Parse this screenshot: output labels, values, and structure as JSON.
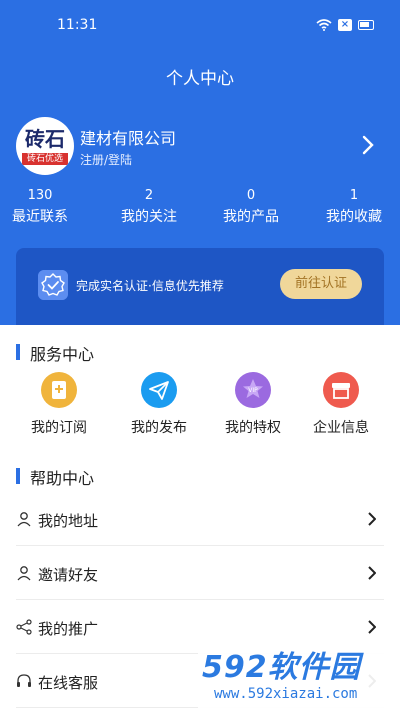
{
  "status_bar": {
    "time": "11:31"
  },
  "header": {
    "title": "个人中心"
  },
  "profile": {
    "logo_text": "砖石",
    "logo_band": "砖石优选",
    "company": "建材有限公司",
    "login": "注册/登陆"
  },
  "stats": [
    {
      "value": "130",
      "label": "最近联系"
    },
    {
      "value": "2",
      "label": "我的关注"
    },
    {
      "value": "0",
      "label": "我的产品"
    },
    {
      "value": "1",
      "label": "我的收藏"
    }
  ],
  "verify": {
    "text": "完成实名认证·信息优先推荐",
    "button": "前往认证"
  },
  "service_center": {
    "title": "服务中心",
    "items": [
      {
        "label": "我的订阅",
        "icon": "bookmark-icon",
        "color": "#f0b43c"
      },
      {
        "label": "我的发布",
        "icon": "send-icon",
        "color": "#1b9cf0"
      },
      {
        "label": "我的特权",
        "icon": "vip-icon",
        "color": "#9b6ae0"
      },
      {
        "label": "企业信息",
        "icon": "store-icon",
        "color": "#ef5a4e"
      }
    ]
  },
  "help_center": {
    "title": "帮助中心",
    "items": [
      {
        "label": "我的地址",
        "icon": "user-icon"
      },
      {
        "label": "邀请好友",
        "icon": "user-icon"
      },
      {
        "label": "我的推广",
        "icon": "share-icon"
      },
      {
        "label": "在线客服",
        "icon": "headset-icon"
      }
    ]
  },
  "watermark": {
    "brand": "592软件园",
    "url": "www.592xiazai.com"
  }
}
